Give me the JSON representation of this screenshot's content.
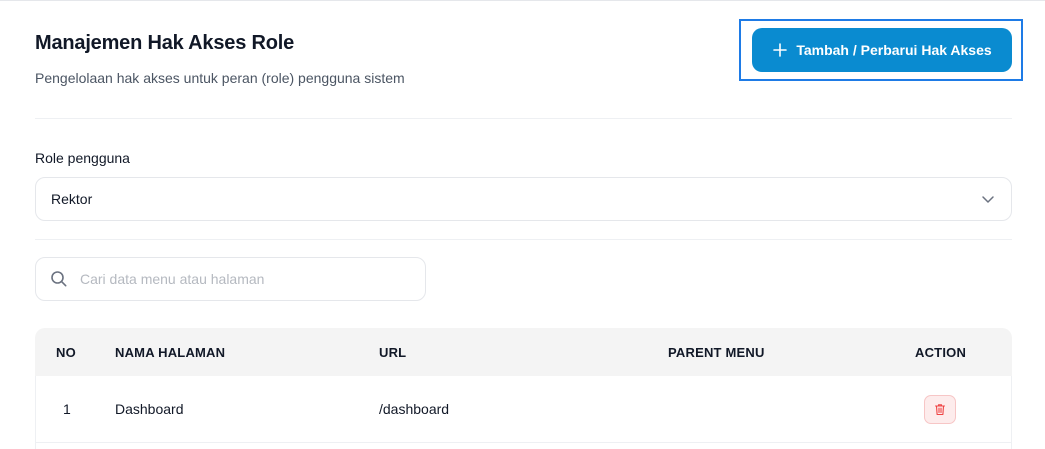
{
  "header": {
    "title": "Manajemen Hak Akses Role",
    "subtitle": "Pengelolaan hak akses untuk peran (role) pengguna sistem",
    "add_button_label": "Tambah / Perbarui Hak Akses"
  },
  "role": {
    "label": "Role pengguna",
    "selected": "Rektor"
  },
  "search": {
    "placeholder": "Cari data menu atau halaman",
    "value": ""
  },
  "table": {
    "columns": [
      "NO",
      "NAMA HALAMAN",
      "URL",
      "PARENT MENU",
      "ACTION"
    ],
    "rows": [
      {
        "no": "1",
        "name": "Dashboard",
        "url": "/dashboard",
        "parent": ""
      }
    ]
  },
  "colors": {
    "primary": "#0a8bd0",
    "highlight": "#1e7be6",
    "danger": "#ef4444",
    "danger_bg": "#fdecec"
  },
  "icons": {
    "add": "plus-icon",
    "dropdown": "chevron-down-icon",
    "search": "search-icon",
    "delete": "trash-icon"
  }
}
